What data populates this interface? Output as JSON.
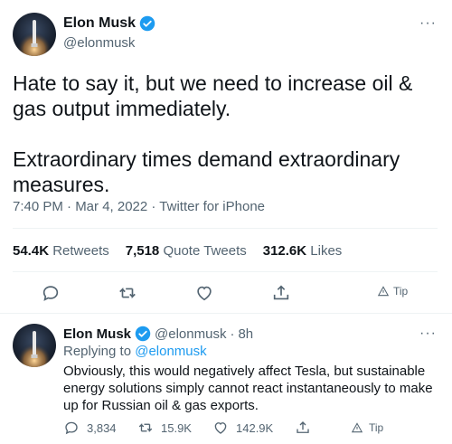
{
  "main_tweet": {
    "author_name": "Elon Musk",
    "author_handle": "@elonmusk",
    "text": "Hate to say it, but we need to increase oil & gas output immediately.\n\nExtraordinary times demand extraordinary measures.",
    "timestamp": "7:40 PM · Mar 4, 2022 · Twitter for iPhone",
    "stats": {
      "retweets_count": "54.4K",
      "retweets_label": "Retweets",
      "quotes_count": "7,518",
      "quotes_label": "Quote Tweets",
      "likes_count": "312.6K",
      "likes_label": "Likes"
    },
    "actions": {
      "reply_icon": "reply-icon",
      "retweet_icon": "retweet-icon",
      "like_icon": "heart-icon",
      "share_icon": "share-icon",
      "tip_label": "Tip"
    },
    "more": "···"
  },
  "reply_tweet": {
    "author_name": "Elon Musk",
    "author_handle": "@elonmusk",
    "time_ago": "8h",
    "replying_to_prefix": "Replying to",
    "replying_to_handle": "@elonmusk",
    "text": "Obviously, this would negatively affect Tesla, but sustainable energy solutions simply cannot react instantaneously to make up for Russian oil & gas exports.",
    "reply_count": "3,834",
    "retweet_count": "15.9K",
    "like_count": "142.9K",
    "tip_label": "Tip",
    "more": "···"
  },
  "colors": {
    "verified_blue": "#1d9bf0",
    "text_primary": "#0f1419",
    "text_secondary": "#536471",
    "link": "#1d9bf0",
    "divider": "#eff3f4"
  }
}
